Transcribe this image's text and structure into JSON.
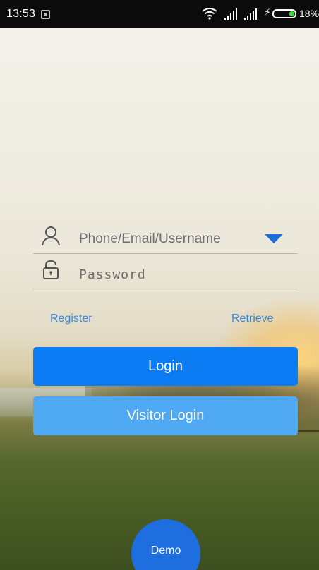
{
  "status_bar": {
    "time": "13:53",
    "battery_percent": "18%",
    "battery_level": 0.18,
    "battery_color": "#3fd43a"
  },
  "login_form": {
    "username_placeholder": "Phone/Email/Username",
    "password_placeholder": "Password",
    "register_label": "Register",
    "retrieve_label": "Retrieve",
    "login_label": "Login",
    "visitor_login_label": "Visitor Login"
  },
  "demo_label": "Demo",
  "colors": {
    "primary": "#0b7cf3",
    "secondary": "#4fa8f2",
    "link": "#3a8be0",
    "demo": "#1f6ee0"
  },
  "icons": [
    "photo-icon",
    "wifi-icon",
    "signal-icon",
    "charging-icon",
    "battery-icon",
    "user-icon",
    "lock-icon",
    "dropdown-arrow-icon"
  ]
}
